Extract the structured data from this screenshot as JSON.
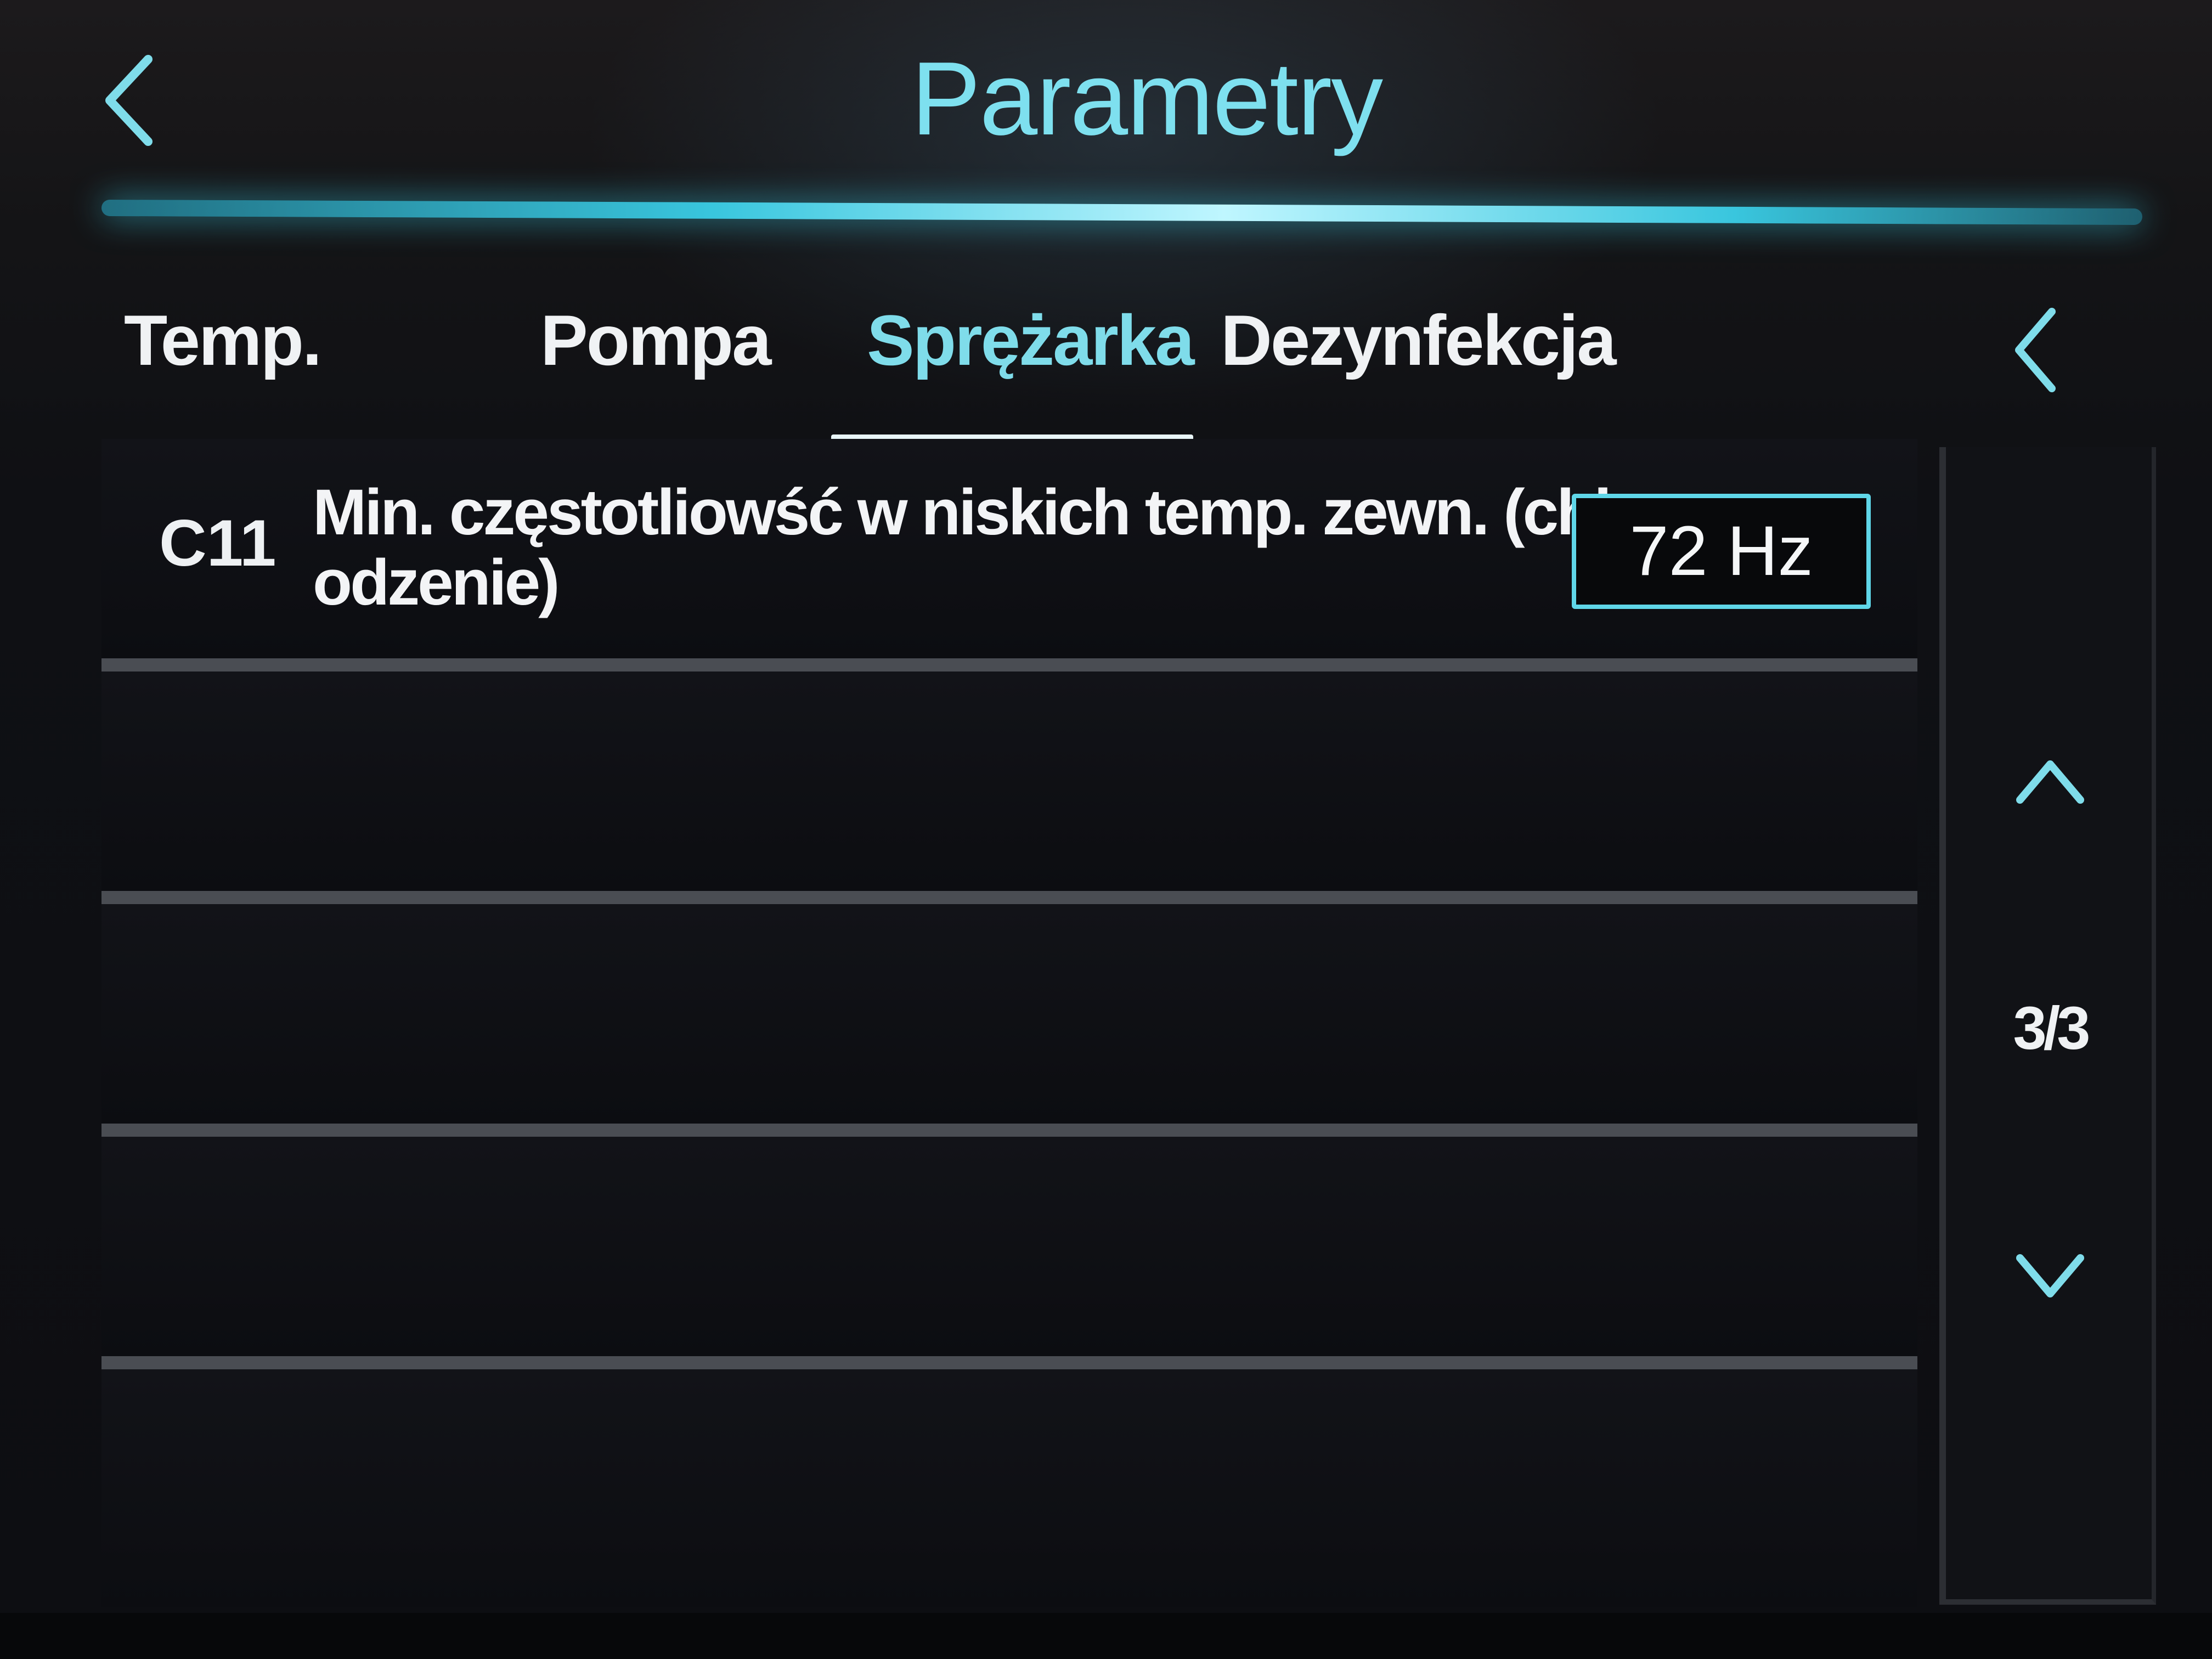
{
  "header": {
    "title": "Parametry",
    "back_icon": "chevron-left-icon"
  },
  "tabs": [
    {
      "label": "Temp.",
      "active": false
    },
    {
      "label": "Pompa",
      "active": false
    },
    {
      "label": "Sprężarka",
      "active": true
    },
    {
      "label": "Dezynfekcja",
      "active": false
    }
  ],
  "tabs_scroll_icon": "chevron-left-icon",
  "parameters": [
    {
      "code": "C11",
      "description": "Min. częstotliowść w niskich temp. zewn. (chłodzenie)",
      "value": "72 Hz"
    }
  ],
  "pager": {
    "page_indicator": "3/3",
    "up_icon": "chevron-up-icon",
    "down_icon": "chevron-down-icon"
  },
  "colors": {
    "accent": "#5fd6e8",
    "title": "#7ee0ef",
    "background": "#0c0d10",
    "divider": "#4a4d53"
  }
}
